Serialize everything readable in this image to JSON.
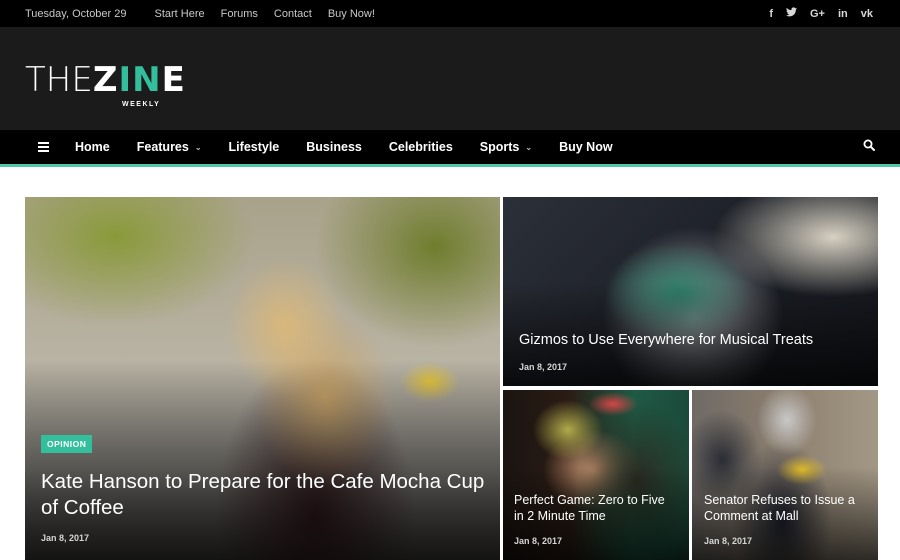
{
  "topbar": {
    "date": "Tuesday, October 29",
    "links": [
      "Start Here",
      "Forums",
      "Contact",
      "Buy Now!"
    ],
    "social": [
      {
        "icon": "facebook-icon",
        "glyph": "f"
      },
      {
        "icon": "twitter-icon",
        "glyph": "🐦"
      },
      {
        "icon": "google-plus-icon",
        "glyph": "G+"
      },
      {
        "icon": "linkedin-icon",
        "glyph": "in"
      },
      {
        "icon": "vk-icon",
        "glyph": "vk"
      }
    ]
  },
  "logo": {
    "thin": "THE",
    "bold1": "Z",
    "accent": "IN",
    "bold2": "E",
    "subtitle": "WEEKLY"
  },
  "nav": {
    "menu_icon": "≡",
    "items": [
      {
        "label": "Home",
        "dropdown": false
      },
      {
        "label": "Features",
        "dropdown": true
      },
      {
        "label": "Lifestyle",
        "dropdown": false
      },
      {
        "label": "Business",
        "dropdown": false
      },
      {
        "label": "Celebrities",
        "dropdown": false
      },
      {
        "label": "Sports",
        "dropdown": true
      },
      {
        "label": "Buy Now",
        "dropdown": false
      }
    ],
    "chevron": "⌄"
  },
  "colors": {
    "accent": "#34bf9c",
    "nav_border": "#4fc7a6",
    "header_bg": "#1b1b1b",
    "topbar_bg": "#000000"
  },
  "featured": {
    "main": {
      "category": "OPINION",
      "title": "Kate Hanson to Prepare for the Cafe Mocha Cup of Coffee",
      "date": "Jan 8, 2017"
    },
    "top_right": {
      "title": "Gizmos to Use Everywhere for Musical Treats",
      "date": "Jan 8, 2017"
    },
    "bottom_left": {
      "title": "Perfect Game: Zero to Five in 2 Minute Time",
      "date": "Jan 8, 2017"
    },
    "bottom_right": {
      "title": "Senator Refuses to Issue a Comment at Mall",
      "date": "Jan 8, 2017"
    }
  }
}
